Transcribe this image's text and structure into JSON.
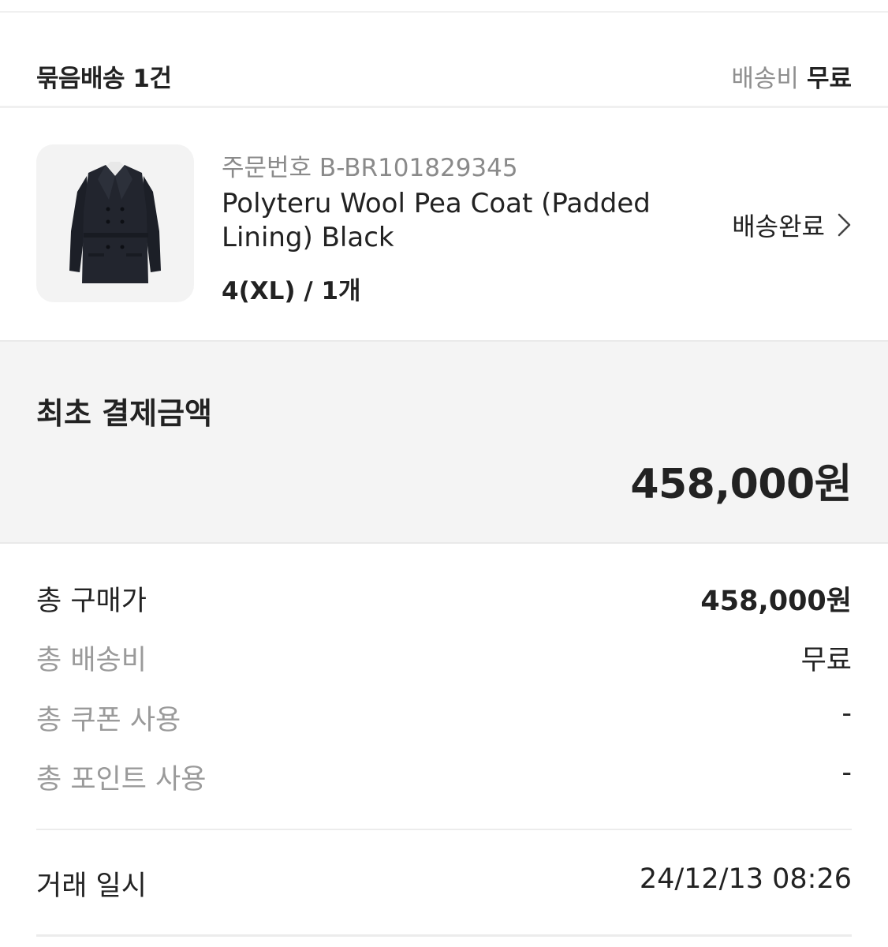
{
  "bundle": {
    "title": "묶음배송 1건",
    "shipping_label": "배송비",
    "shipping_value": "무료"
  },
  "product": {
    "order_number": "주문번호 B-BR101829345",
    "name": "Polyteru Wool Pea Coat (Padded Lining) Black",
    "option": "4(XL) / 1개",
    "status": "배송완료",
    "status_icon": "chevron-right-icon"
  },
  "payment": {
    "title": "최초 결제금액",
    "amount": "458,000원"
  },
  "summary": [
    {
      "label": "총 구매가",
      "value": "458,000원"
    },
    {
      "label": "총 배송비",
      "value": "무료"
    },
    {
      "label": "총 쿠폰 사용",
      "value": "-"
    },
    {
      "label": "총 포인트 사용",
      "value": "-"
    }
  ],
  "transaction": {
    "label": "거래 일시",
    "value": "24/12/13 08:26"
  },
  "colors": {
    "text": "#222222",
    "muted": "#8f8f8f",
    "panel": "#f4f4f4",
    "divider": "#ececec"
  }
}
